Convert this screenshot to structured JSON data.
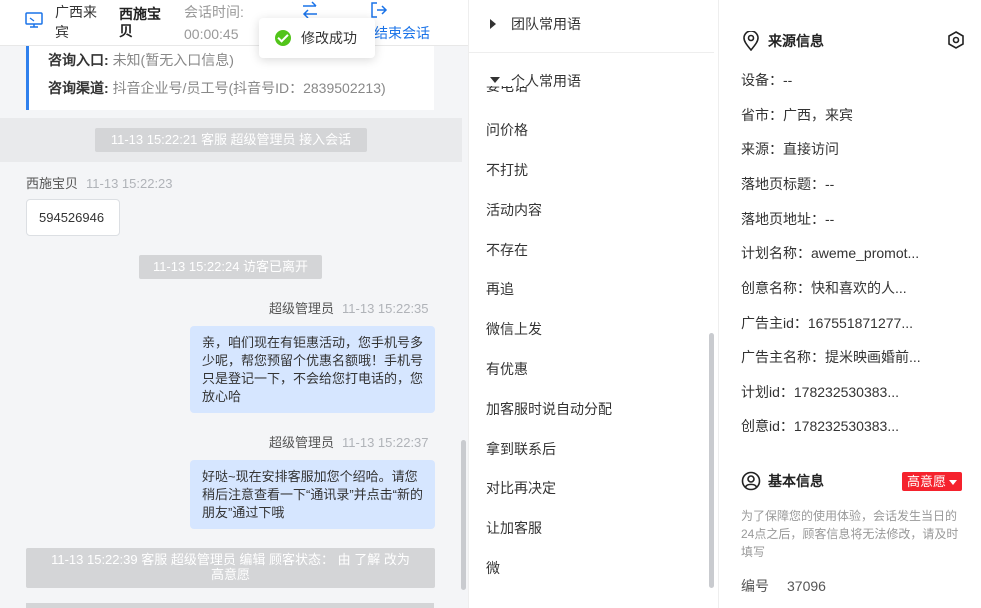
{
  "header": {
    "region": "广西来宾",
    "user_name": "西施宝贝",
    "time_label": "会话时间:",
    "time_value": "00:00:45",
    "end_label": "结束会话"
  },
  "toast": {
    "text": "修改成功"
  },
  "info_card": {
    "entry_label": "咨询入口:",
    "entry_value": "未知(暂无入口信息)",
    "channel_label": "咨询渠道:",
    "channel_value": "抖音企业号/员工号(抖音号ID：2839502213)"
  },
  "messages": {
    "sys1": "11-13 15:22:21 客服 超级管理员 接入会话",
    "visitor_name": "西施宝贝",
    "visitor_time": "11-13 15:22:23",
    "visitor_text": "594526946",
    "sys2": "11-13 15:22:24 访客已离开",
    "agent1_name": "超级管理员",
    "agent1_time": "11-13 15:22:35",
    "agent1_text": "亲，咱们现在有钜惠活动，您手机号多少呢，帮您预留个优惠名额哦！手机号只是登记一下，不会给您打电话的，您放心哈",
    "agent2_name": "超级管理员",
    "agent2_time": "11-13 15:22:37",
    "agent2_text": "好哒~现在安排客服加您个绍哈。请您稍后注意查看一下“通讯录”并点击“新的朋友”通过下哦",
    "sys3": "11-13 15:22:39 客服 超级管理员 编辑 顾客状态： 由 了解 改为 高意愿"
  },
  "phrases": {
    "team_group": "团队常用语",
    "personal_group": "个人常用语",
    "clipped_item": "要电话",
    "items": [
      "问价格",
      "不打扰",
      "活动内容",
      "不存在",
      "再追",
      "微信上发",
      "有优惠",
      "加客服时说自动分配",
      "拿到联系后",
      "对比再决定",
      "让加客服",
      "微"
    ]
  },
  "source_info": {
    "title": "来源信息",
    "rows": [
      "设备：--",
      "省市：广西，来宾",
      "来源：直接访问",
      "落地页标题：--",
      "落地页地址：--",
      "计划名称：aweme_promot...",
      "创意名称：快和喜欢的人...",
      "广告主id：167551871277...",
      "广告主名称：提米映画婚前...",
      "计划id：178232530383...",
      "创意id：178232530383..."
    ]
  },
  "basic_info": {
    "title": "基本信息",
    "badge": "高意愿",
    "note": "为了保障您的使用体验，会话发生当日的24点之后，顾客信息将无法修改，请及时填写",
    "number_label": "编号",
    "number_value": "37096"
  },
  "colors": {
    "accent": "#1a73e8",
    "bubble_out": "#d6e6ff",
    "badge_red": "#f5222d",
    "success": "#52c41a"
  },
  "icons": {
    "header_monitor": "monitor-icon",
    "transfer": "transfer-icon",
    "end_session": "logout-icon",
    "toast": "check-circle-icon",
    "location": "location-icon",
    "settings": "hexagon-settings-icon",
    "person": "person-circle-icon"
  }
}
